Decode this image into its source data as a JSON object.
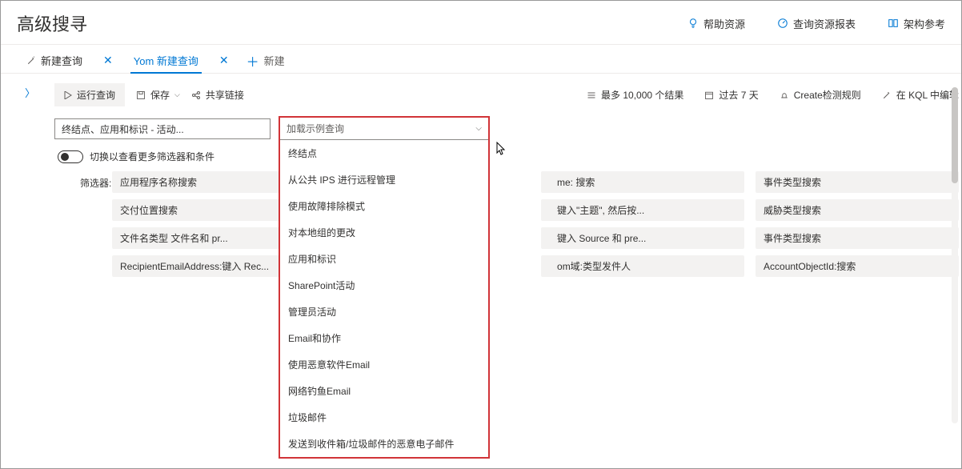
{
  "page_title": "高级搜寻",
  "header_links": {
    "help": "帮助资源",
    "report": "查询资源报表",
    "schema": "架构参考"
  },
  "tabs": {
    "first": "新建查询",
    "active": "Yom 新建查询",
    "newtab": "新建"
  },
  "toolbar": {
    "run": "运行查询",
    "save": "保存",
    "share": "共享链接",
    "results": "最多 10,000 个结果",
    "timerange": "过去 7 天",
    "detect": "Create检测规则",
    "kql": "在 KQL 中编辑"
  },
  "filter_input": "终结点、应用和标识 - 活动...",
  "dropdown": {
    "placeholder": "加载示例查询",
    "items": [
      "终结点",
      "从公共 IPS 进行远程管理",
      "使用故障排除模式",
      "对本地组的更改",
      "应用和标识",
      "SharePoint活动",
      "管理员活动",
      "Email和协作",
      "使用恶意软件Email",
      "网络钓鱼Email",
      "垃圾邮件",
      "发送到收件箱/垃圾邮件的恶意电子邮件"
    ]
  },
  "toggle_label": "切换以查看更多筛选器和条件",
  "filters_label": "筛选器:",
  "chips": {
    "r1c1": "应用程序名称搜索",
    "r1c3": "me: 搜索",
    "r1c4": "事件类型搜索",
    "r2c1": "交付位置搜索",
    "r2c3": "键入\"主题\", 然后按...",
    "r2c4": "威胁类型搜索",
    "r3c1": "文件名类型 文件名和 pr...",
    "r3c3": "键入 Source 和 pre...",
    "r3c4": "事件类型搜索",
    "r4c1": "RecipientEmailAddress:键入 Rec...",
    "r4c3": "om域:类型发件人",
    "r4c4": "AccountObjectId:搜索"
  }
}
